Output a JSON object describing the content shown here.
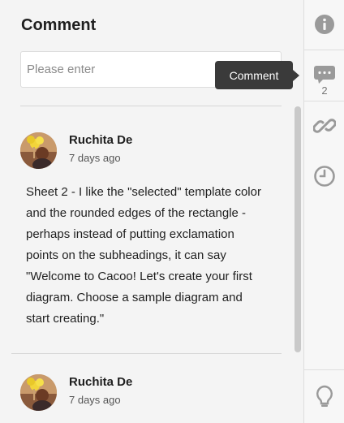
{
  "panel": {
    "title": "Comment",
    "input": {
      "placeholder": "Please enter",
      "value": ""
    }
  },
  "comments": [
    {
      "author": "Ruchita De",
      "time": "7 days ago",
      "text": "Sheet 2 - I like the \"selected\" template color and the rounded edges of the rectangle - perhaps instead of putting exclamation points on the subheadings, it can say \"Welcome to Cacoo! Let's create your first diagram. Choose a sample diagram and start creating.\""
    },
    {
      "author": "Ruchita De",
      "time": "7 days ago",
      "text": ""
    }
  ],
  "rail": {
    "info_icon": "info-icon",
    "comment_icon": "comment-icon",
    "comment_count": "2",
    "link_icon": "link-icon",
    "history_icon": "clock-icon",
    "tips_icon": "lightbulb-icon"
  },
  "tooltip": {
    "text": "Comment"
  },
  "colors": {
    "icon": "#9a9a9a",
    "tooltip_bg": "#3a3a3a",
    "panel_bg": "#f4f4f4"
  }
}
